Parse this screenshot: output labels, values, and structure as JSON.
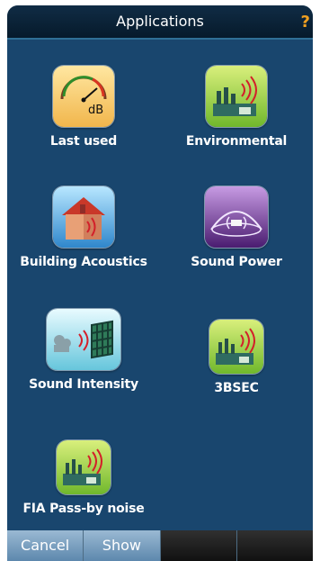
{
  "header": {
    "title": "Applications",
    "help_icon": "?"
  },
  "apps": [
    {
      "label": "Last used",
      "icon": "gauge-icon"
    },
    {
      "label": "Environmental",
      "icon": "factory-icon"
    },
    {
      "label": "Building Acoustics",
      "icon": "house-icon"
    },
    {
      "label": "Sound Power",
      "icon": "dome-icon"
    },
    {
      "label": "Sound Intensity",
      "icon": "intensity-icon"
    },
    {
      "label": "3BSEC",
      "icon": "factory-icon"
    },
    {
      "label": "FIA Pass-by noise",
      "icon": "factory-icon"
    }
  ],
  "softkeys": {
    "cancel": "Cancel",
    "show": "Show"
  },
  "colors": {
    "background": "#19466e",
    "accent": "#f0a020"
  }
}
